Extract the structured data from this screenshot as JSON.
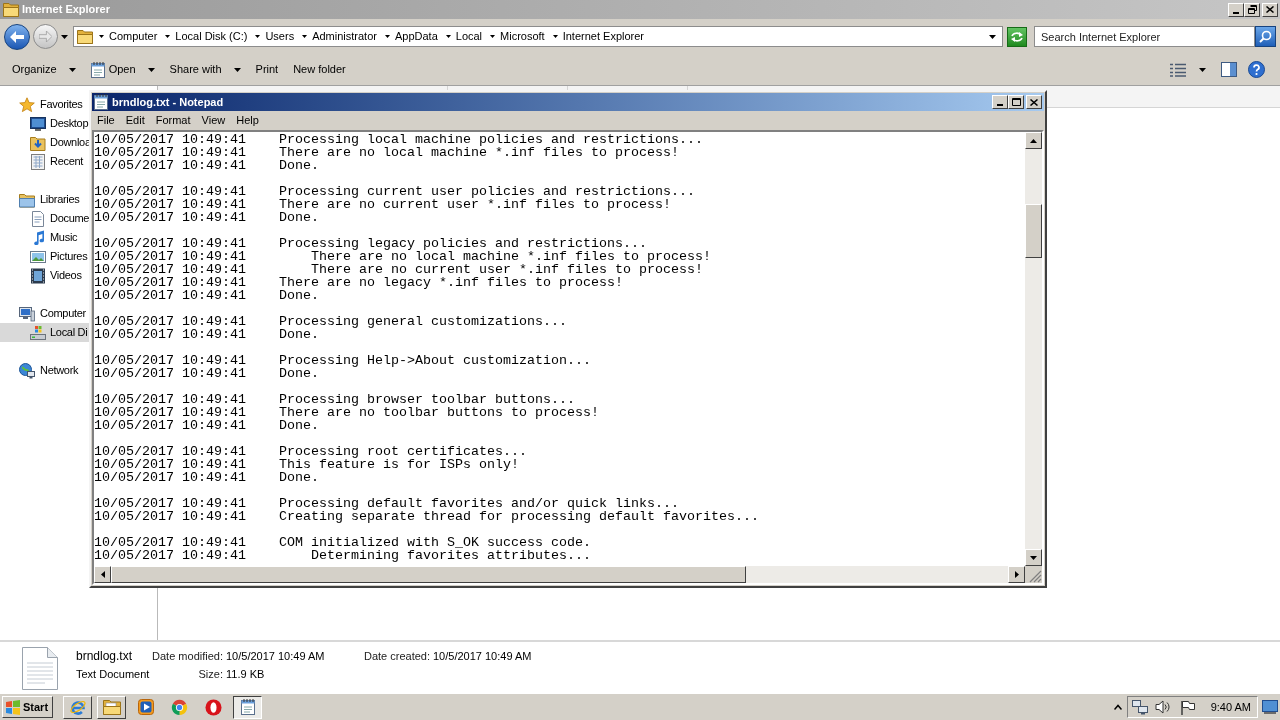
{
  "explorer": {
    "title": "Internet Explorer",
    "address_bar": {
      "segments": [
        "Computer",
        "Local Disk (C:)",
        "Users",
        "Administrator",
        "AppData",
        "Local",
        "Microsoft",
        "Internet Explorer"
      ]
    },
    "search": {
      "placeholder": "Search Internet Explorer"
    },
    "toolbar": [
      {
        "label": "Organize",
        "kind": "plain",
        "dropdown": true
      },
      {
        "label": "Open",
        "kind": "file",
        "dropdown": true
      },
      {
        "label": "Share with",
        "kind": "plain",
        "dropdown": true
      },
      {
        "label": "Print",
        "kind": "plain",
        "dropdown": false
      },
      {
        "label": "New folder",
        "kind": "plain",
        "dropdown": false
      }
    ],
    "nav_pane": [
      {
        "label": "Favorites",
        "kind": "star",
        "selected": false,
        "children": [
          {
            "label": "Desktop",
            "kind": "desktop",
            "selected": false
          },
          {
            "label": "Downloa",
            "kind": "downloads",
            "selected": false
          },
          {
            "label": "Recent",
            "kind": "recent",
            "selected": false
          }
        ]
      },
      {
        "label": "Libraries",
        "kind": "library",
        "selected": false,
        "children": [
          {
            "label": "Docume",
            "kind": "documents",
            "selected": false
          },
          {
            "label": "Music",
            "kind": "music",
            "selected": false
          },
          {
            "label": "Pictures",
            "kind": "pictures",
            "selected": false
          },
          {
            "label": "Videos",
            "kind": "videos",
            "selected": false
          }
        ]
      },
      {
        "label": "Computer",
        "kind": "computer",
        "selected": false,
        "children": [
          {
            "label": "Local Di",
            "kind": "drive",
            "selected": true
          }
        ]
      },
      {
        "label": "Network",
        "kind": "network",
        "selected": false
      }
    ],
    "details_pane": {
      "file_name": "brndlog.txt",
      "file_type": "Text Document",
      "properties": [
        {
          "label": "Date modified:",
          "value": "10/5/2017 10:49 AM"
        },
        {
          "label": "Date created:",
          "value": "10/5/2017 10:49 AM"
        },
        {
          "label": "Size:",
          "value": "11.9 KB"
        }
      ]
    }
  },
  "notepad": {
    "title": "brndlog.txt - Notepad",
    "menu": [
      "File",
      "Edit",
      "Format",
      "View",
      "Help"
    ],
    "log": [
      [
        {
          "time": "10/05/2017 10:49:41",
          "message": "Processing local machine policies and restrictions..."
        },
        {
          "time": "10/05/2017 10:49:41",
          "message": "There are no local machine *.inf files to process!"
        },
        {
          "time": "10/05/2017 10:49:41",
          "message": "Done."
        }
      ],
      [
        {
          "time": "10/05/2017 10:49:41",
          "message": "Processing current user policies and restrictions..."
        },
        {
          "time": "10/05/2017 10:49:41",
          "message": "There are no current user *.inf files to process!"
        },
        {
          "time": "10/05/2017 10:49:41",
          "message": "Done."
        }
      ],
      [
        {
          "time": "10/05/2017 10:49:41",
          "message": "Processing legacy policies and restrictions...",
          "children": [
            {
              "time": "10/05/2017 10:49:41",
              "message": "There are no local machine *.inf files to process!"
            },
            {
              "time": "10/05/2017 10:49:41",
              "message": "There are no current user *.inf files to process!"
            }
          ]
        },
        {
          "time": "10/05/2017 10:49:41",
          "message": "There are no legacy *.inf files to process!"
        },
        {
          "time": "10/05/2017 10:49:41",
          "message": "Done."
        }
      ],
      [
        {
          "time": "10/05/2017 10:49:41",
          "message": "Processing general customizations..."
        },
        {
          "time": "10/05/2017 10:49:41",
          "message": "Done."
        }
      ],
      [
        {
          "time": "10/05/2017 10:49:41",
          "message": "Processing Help->About customization..."
        },
        {
          "time": "10/05/2017 10:49:41",
          "message": "Done."
        }
      ],
      [
        {
          "time": "10/05/2017 10:49:41",
          "message": "Processing browser toolbar buttons..."
        },
        {
          "time": "10/05/2017 10:49:41",
          "message": "There are no toolbar buttons to process!"
        },
        {
          "time": "10/05/2017 10:49:41",
          "message": "Done."
        }
      ],
      [
        {
          "time": "10/05/2017 10:49:41",
          "message": "Processing root certificates..."
        },
        {
          "time": "10/05/2017 10:49:41",
          "message": "This feature is for ISPs only!"
        },
        {
          "time": "10/05/2017 10:49:41",
          "message": "Done."
        }
      ],
      [
        {
          "time": "10/05/2017 10:49:41",
          "message": "Processing default favorites and/or quick links..."
        },
        {
          "time": "10/05/2017 10:49:41",
          "message": "Creating separate thread for processing default favorites..."
        }
      ],
      [
        {
          "time": "10/05/2017 10:49:41",
          "message": "COM initialized with S_OK success code.",
          "children": [
            {
              "time": "10/05/2017 10:49:41",
              "message": "Determining favorites attributes..."
            }
          ]
        }
      ]
    ]
  },
  "taskbar": {
    "start": "Start",
    "buttons": [
      {
        "running": true,
        "selected": false
      },
      {
        "running": true,
        "selected": false
      },
      {
        "running": false,
        "selected": false
      },
      {
        "running": false,
        "selected": false
      },
      {
        "running": false,
        "selected": false
      },
      {
        "running": true,
        "selected": true
      }
    ],
    "clock": "9:40 AM"
  }
}
